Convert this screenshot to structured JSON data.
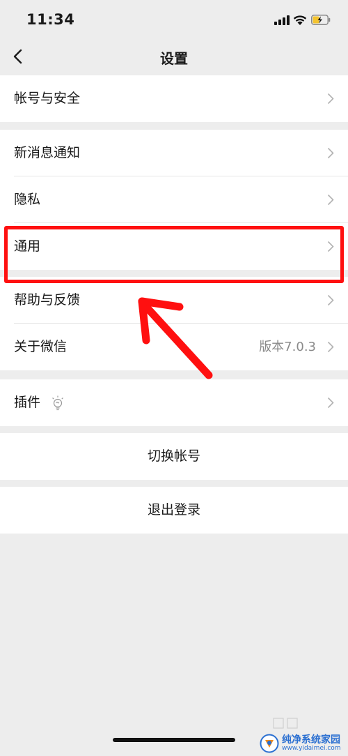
{
  "status_bar": {
    "time": "11:34"
  },
  "nav": {
    "title": "设置"
  },
  "groups": {
    "account": {
      "items": [
        {
          "label": "帐号与安全"
        }
      ]
    },
    "main": {
      "items": [
        {
          "label": "新消息通知"
        },
        {
          "label": "隐私"
        },
        {
          "label": "通用"
        },
        {
          "label": "帮助与反馈"
        },
        {
          "label": "关于微信",
          "value": "版本7.0.3"
        }
      ]
    },
    "plugins": {
      "items": [
        {
          "label": "插件"
        }
      ]
    }
  },
  "actions": {
    "switch_account": "切换帐号",
    "logout": "退出登录"
  },
  "watermark": {
    "title": "纯净系统家园",
    "url": "www.yidaimei.com"
  },
  "colors": {
    "highlight": "#ff1010",
    "background": "#ededed",
    "chevron": "#b2b2b2",
    "watermark": "#2a6fd1"
  }
}
